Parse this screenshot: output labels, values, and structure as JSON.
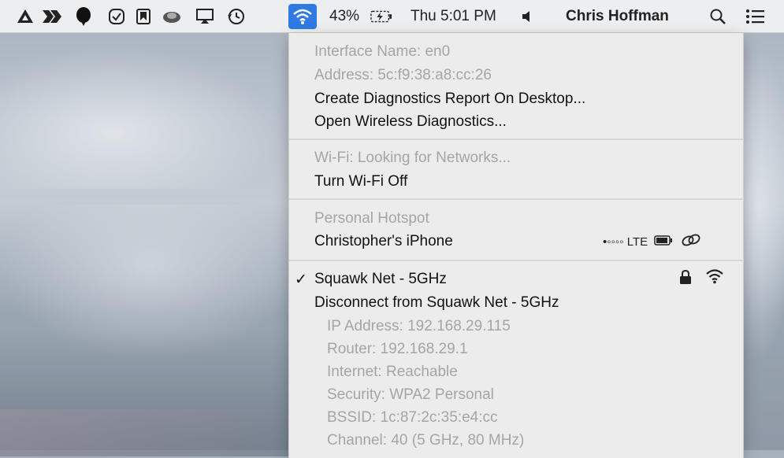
{
  "menubar": {
    "icons": [
      "google-drive-icon",
      "flow-icon",
      "balloon-icon",
      "checkmark-circle-icon",
      "bookmark-icon",
      "cloud-icon",
      "airplay-icon",
      "time-machine-icon",
      "wifi-icon"
    ],
    "battery_text": "43%",
    "clock": "Thu 5:01 PM",
    "user": "Chris Hoffman",
    "accent": "#2f7ae5"
  },
  "menu": {
    "interface_name": "Interface Name: en0",
    "address": "Address: 5c:f9:38:a8:cc:26",
    "create_report": "Create Diagnostics Report On Desktop...",
    "open_diagnostics": "Open Wireless Diagnostics...",
    "wifi_status": "Wi-Fi: Looking for Networks...",
    "turn_off": "Turn Wi-Fi Off",
    "hotspot_header": "Personal Hotspot",
    "hotspot_device": "Christopher's iPhone",
    "hotspot_signal": "•◦◦◦◦ LTE",
    "check_mark": "✓",
    "network": "Squawk Net - 5GHz",
    "disconnect": "Disconnect from Squawk Net - 5GHz",
    "details": [
      "IP Address: 192.168.29.115",
      "Router: 192.168.29.1",
      "Internet: Reachable",
      "Security: WPA2 Personal",
      "BSSID: 1c:87:2c:35:e4:cc",
      "Channel: 40 (5 GHz, 80 MHz)"
    ]
  }
}
